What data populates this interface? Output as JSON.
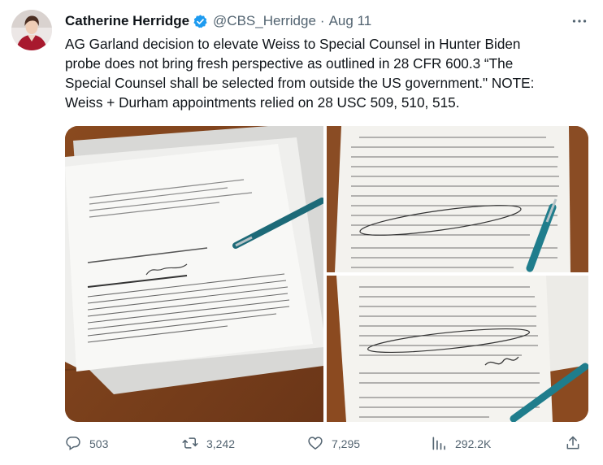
{
  "tweet": {
    "author_name": "Catherine Herridge",
    "handle": "@CBS_Herridge",
    "separator": "·",
    "date": "Aug 11",
    "text_lines": [
      "AG Garland decision to elevate Weiss to Special Counsel in Hunter Biden",
      "probe does not bring fresh perspective as outlined in 28 CFR 600.3 “The",
      "Special Counsel shall be selected from outside the US government.\" NOTE:",
      "Weiss + Durham appointments relied on 28 USC 509, 510, 515."
    ]
  },
  "actions": {
    "replies": "503",
    "retweets": "3,242",
    "likes": "7,295",
    "views": "292.2K"
  },
  "icons": {
    "verified": "verified-badge-icon",
    "more": "more-options-icon",
    "reply": "reply-icon",
    "retweet": "retweet-icon",
    "like": "heart-icon",
    "views": "views-chart-icon",
    "share": "share-icon"
  },
  "colors": {
    "verified_blue": "#1d9bf0",
    "secondary_text": "#536471",
    "primary_text": "#0f1419"
  }
}
